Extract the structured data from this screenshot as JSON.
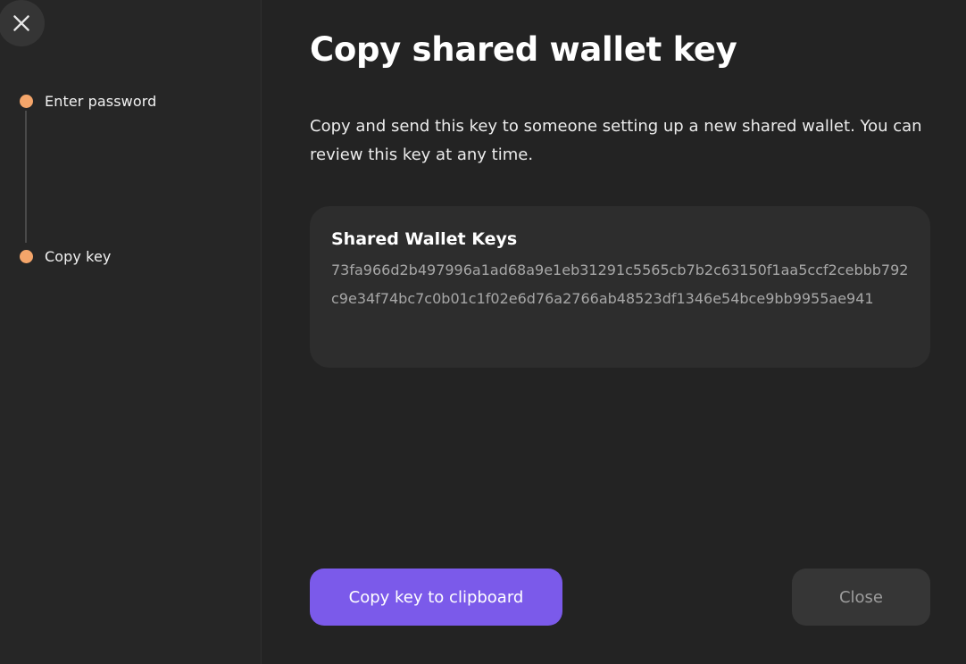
{
  "sidebar": {
    "close_icon": "close-icon",
    "steps": [
      {
        "label": "Enter password"
      },
      {
        "label": "Copy key"
      }
    ]
  },
  "main": {
    "title": "Copy shared wallet key",
    "description": "Copy and send this key to someone setting up a new shared wallet. You can review this key at any time.",
    "key_card": {
      "title": "Shared Wallet Keys",
      "value": "73fa966d2b497996a1ad68a9e1eb31291c5565cb7b2c63150f1aa5ccf2cebbb792c9e34f74bc7c0b01c1f02e6d76a2766ab48523df1346e54bce9bb9955ae941"
    },
    "copy_button_label": "Copy key to clipboard",
    "close_button_label": "Close"
  },
  "colors": {
    "background": "#232323",
    "step_dot": "#f4a56a",
    "primary_button": "#7b5aea",
    "secondary_button": "#363636",
    "card": "#2d2d2d"
  }
}
